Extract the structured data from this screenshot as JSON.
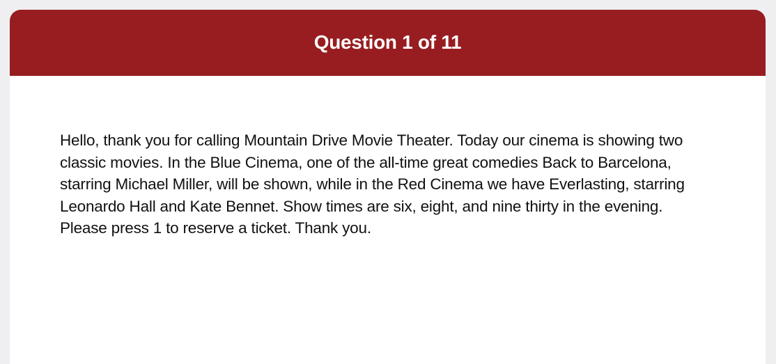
{
  "header": {
    "title": "Question 1 of 11"
  },
  "question": {
    "text": "Hello, thank you for calling Mountain Drive Movie Theater. Today our cinema is showing two classic movies. In the Blue Cinema, one of the all-time great comedies Back to Barcelona, starring Michael Miller, will be shown, while in the Red Cinema we have Everlasting, starring Leonardo Hall and Kate Bennet. Show times are six, eight, and nine thirty in the evening. Please press 1 to reserve a ticket. Thank you."
  },
  "colors": {
    "header_background": "#971d20",
    "header_text": "#ffffff",
    "page_background": "#efeff2",
    "card_background": "#ffffff",
    "body_text": "#111111"
  }
}
